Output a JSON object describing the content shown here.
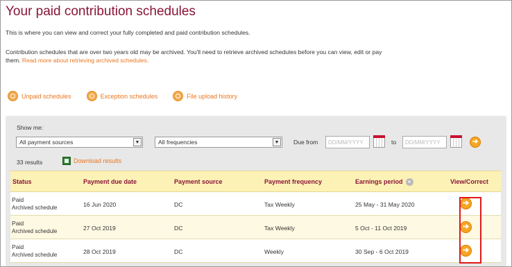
{
  "page": {
    "title": "Your paid contribution schedules",
    "intro": "This is where you can view and correct your fully completed and paid contribution schedules.",
    "archive_text": "Contribution schedules that are over two years old may be archived. You'll need to retrieve archived schedules before you can view, edit or pay them.",
    "archive_link": "Read more about retrieving archived schedules."
  },
  "quicklinks": [
    {
      "label": "Unpaid schedules",
      "icon": "search-icon"
    },
    {
      "label": "Exception schedules",
      "icon": "search-icon"
    },
    {
      "label": "File upload history",
      "icon": "search-icon"
    }
  ],
  "filters": {
    "show_me_label": "Show me:",
    "payment_source": "All payment sources",
    "frequency": "All frequencies",
    "due_from_label": "Due from",
    "from_placeholder": "DD/MM/YYYY",
    "to_label": "to",
    "to_placeholder": "DD/MM/YYYY"
  },
  "results": {
    "count": "33 results",
    "download_label": "Download results"
  },
  "table": {
    "headers": {
      "status": "Status",
      "due": "Payment due date",
      "source": "Payment source",
      "frequency": "Payment frequency",
      "earnings": "Earnings period",
      "view": "View/Correct"
    },
    "rows": [
      {
        "status": "Paid",
        "sub": "Archived schedule",
        "due": "16 Jun 2020",
        "source": "DC",
        "frequency": "Tax Weekly",
        "earnings": "25 May - 31 May 2020"
      },
      {
        "status": "Paid",
        "sub": "Archived schedule",
        "due": "27 Oct 2019",
        "source": "DC",
        "frequency": "Tax Weekly",
        "earnings": "5 Oct - 11 Oct 2019"
      },
      {
        "status": "Paid",
        "sub": "Archived schedule",
        "due": "28 Oct 2019",
        "source": "DC",
        "frequency": "Weekly",
        "earnings": "30 Sep - 6 Oct 2019"
      }
    ]
  },
  "colors": {
    "title": "#8a1538",
    "link": "#e87722",
    "header_bg": "#fcf2b5",
    "highlight": "#e0181b"
  }
}
